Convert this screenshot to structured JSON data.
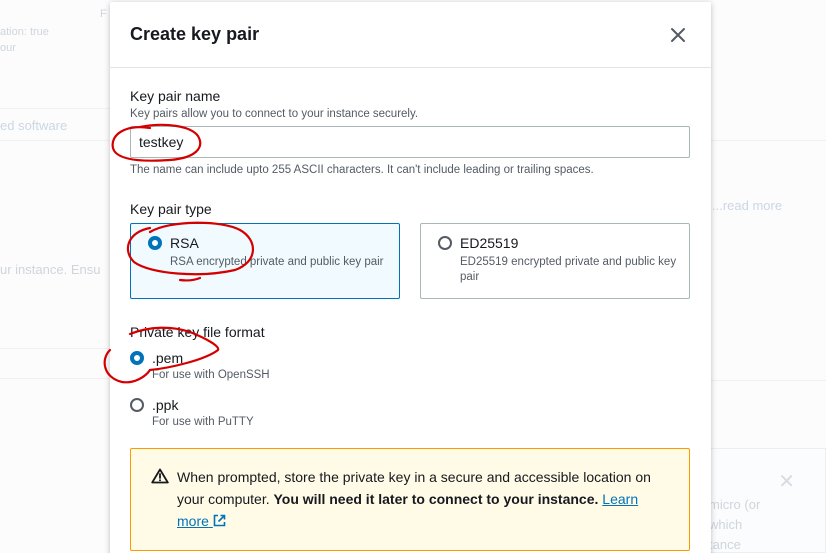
{
  "background": {
    "frag_top": "F",
    "frag_attr_1": "ation: true",
    "frag_attr_2": "our",
    "frag_software": "ed software",
    "frag_instance": "ur instance. Ensu",
    "frag_read_more": "...read more",
    "frag_panel_1": "micro (or",
    "frag_panel_2": "which",
    "frag_panel_3": "tance",
    "close_glyph": "✕"
  },
  "modal": {
    "title": "Create key pair",
    "close_glyph": "✕"
  },
  "key_name": {
    "label": "Key pair name",
    "description": "Key pairs allow you to connect to your instance securely.",
    "value": "testkey",
    "constraint": "The name can include upto 255 ASCII characters. It can't include leading or trailing spaces."
  },
  "key_type": {
    "label": "Key pair type",
    "options": [
      {
        "title": "RSA",
        "description": "RSA encrypted private and public key pair",
        "selected": true
      },
      {
        "title": "ED25519",
        "description": "ED25519 encrypted private and public key pair",
        "selected": false
      }
    ]
  },
  "file_format": {
    "label": "Private key file format",
    "options": [
      {
        "title": ".pem",
        "description": "For use with OpenSSH",
        "selected": true
      },
      {
        "title": ".ppk",
        "description": "For use with PuTTY",
        "selected": false
      }
    ]
  },
  "alert": {
    "icon": "warning-icon",
    "text_plain": "When prompted, store the private key in a secure and accessible location on your computer. ",
    "text_bold": "You will need it later to connect to your instance.",
    "link_label": "Learn more",
    "link_icon": "external-link-icon"
  },
  "colors": {
    "accent": "#0073bb",
    "warning_border": "#ff9900",
    "warning_bg": "#fffbe6",
    "annotation": "#d40000"
  }
}
